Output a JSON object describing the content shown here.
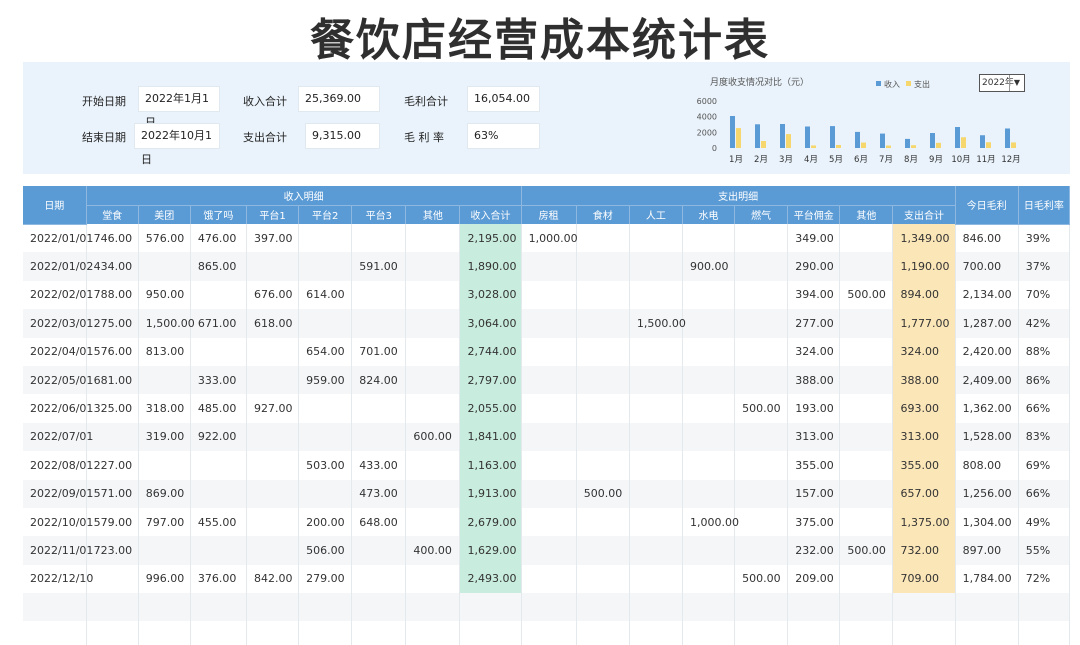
{
  "title": "餐饮店经营成本统计表",
  "summary": {
    "start_label": "开始日期",
    "start_value": "2022年1月1日",
    "end_label": "结束日期",
    "end_value": "2022年10月1日",
    "income_label": "收入合计",
    "income_value": "25,369.00",
    "expense_label": "支出合计",
    "expense_value": "9,315.00",
    "profit_label": "毛利合计",
    "profit_value": "16,054.00",
    "rate_label": "毛 利 率",
    "rate_value": "63%"
  },
  "year_select": "2022年",
  "chart_data": {
    "type": "bar",
    "title": "月度收支情况对比（元）",
    "categories": [
      "1月",
      "2月",
      "3月",
      "4月",
      "5月",
      "6月",
      "7月",
      "8月",
      "9月",
      "10月",
      "11月",
      "12月"
    ],
    "series": [
      {
        "name": "收入",
        "color": "#5b9bd5",
        "values": [
          4085,
          3028,
          3064,
          2744,
          2797,
          2055,
          1841,
          1163,
          1913,
          2679,
          1629,
          2493
        ]
      },
      {
        "name": "支出",
        "color": "#f5d76e",
        "values": [
          2539,
          894,
          1777,
          324,
          388,
          693,
          313,
          355,
          657,
          1375,
          732,
          709
        ]
      }
    ],
    "yticks": [
      "6000",
      "4000",
      "2000",
      "0"
    ],
    "ylim": [
      0,
      6000
    ],
    "legend": "top"
  },
  "table": {
    "date_header": "日期",
    "income_group": "收入明细",
    "expense_group": "支出明细",
    "today_profit_header": "今日毛利",
    "daily_rate_header": "日毛利率",
    "income_cols": [
      "堂食",
      "美团",
      "饿了吗",
      "平台1",
      "平台2",
      "平台3",
      "其他",
      "收入合计"
    ],
    "expense_cols": [
      "房租",
      "食材",
      "人工",
      "水电",
      "燃气",
      "平台佣金",
      "其他",
      "支出合计"
    ],
    "rows": [
      [
        "2022/01/01",
        "746.00",
        "576.00",
        "476.00",
        "397.00",
        "",
        "",
        "",
        "2,195.00",
        "1,000.00",
        "",
        "",
        "",
        "",
        "349.00",
        "",
        "1,349.00",
        "846.00",
        "39%"
      ],
      [
        "2022/01/02",
        "434.00",
        "",
        "865.00",
        "",
        "",
        "591.00",
        "",
        "1,890.00",
        "",
        "",
        "",
        "900.00",
        "",
        "290.00",
        "",
        "1,190.00",
        "700.00",
        "37%"
      ],
      [
        "2022/02/01",
        "788.00",
        "950.00",
        "",
        "676.00",
        "614.00",
        "",
        "",
        "3,028.00",
        "",
        "",
        "",
        "",
        "",
        "394.00",
        "500.00",
        "894.00",
        "2,134.00",
        "70%"
      ],
      [
        "2022/03/01",
        "275.00",
        "1,500.00",
        "671.00",
        "618.00",
        "",
        "",
        "",
        "3,064.00",
        "",
        "",
        "1,500.00",
        "",
        "",
        "277.00",
        "",
        "1,777.00",
        "1,287.00",
        "42%"
      ],
      [
        "2022/04/01",
        "576.00",
        "813.00",
        "",
        "",
        "654.00",
        "701.00",
        "",
        "2,744.00",
        "",
        "",
        "",
        "",
        "",
        "324.00",
        "",
        "324.00",
        "2,420.00",
        "88%"
      ],
      [
        "2022/05/01",
        "681.00",
        "",
        "333.00",
        "",
        "959.00",
        "824.00",
        "",
        "2,797.00",
        "",
        "",
        "",
        "",
        "",
        "388.00",
        "",
        "388.00",
        "2,409.00",
        "86%"
      ],
      [
        "2022/06/01",
        "325.00",
        "318.00",
        "485.00",
        "927.00",
        "",
        "",
        "",
        "2,055.00",
        "",
        "",
        "",
        "",
        "500.00",
        "193.00",
        "",
        "693.00",
        "1,362.00",
        "66%"
      ],
      [
        "2022/07/01",
        "",
        "319.00",
        "922.00",
        "",
        "",
        "",
        "600.00",
        "1,841.00",
        "",
        "",
        "",
        "",
        "",
        "313.00",
        "",
        "313.00",
        "1,528.00",
        "83%"
      ],
      [
        "2022/08/01",
        "227.00",
        "",
        "",
        "",
        "503.00",
        "433.00",
        "",
        "1,163.00",
        "",
        "",
        "",
        "",
        "",
        "355.00",
        "",
        "355.00",
        "808.00",
        "69%"
      ],
      [
        "2022/09/01",
        "571.00",
        "869.00",
        "",
        "",
        "",
        "473.00",
        "",
        "1,913.00",
        "",
        "500.00",
        "",
        "",
        "",
        "157.00",
        "",
        "657.00",
        "1,256.00",
        "66%"
      ],
      [
        "2022/10/01",
        "579.00",
        "797.00",
        "455.00",
        "",
        "200.00",
        "648.00",
        "",
        "2,679.00",
        "",
        "",
        "",
        "1,000.00",
        "",
        "375.00",
        "",
        "1,375.00",
        "1,304.00",
        "49%"
      ],
      [
        "2022/11/01",
        "723.00",
        "",
        "",
        "",
        "506.00",
        "",
        "400.00",
        "1,629.00",
        "",
        "",
        "",
        "",
        "",
        "232.00",
        "500.00",
        "732.00",
        "897.00",
        "55%"
      ],
      [
        "2022/12/10",
        "",
        "996.00",
        "376.00",
        "842.00",
        "279.00",
        "",
        "",
        "2,493.00",
        "",
        "",
        "",
        "",
        "500.00",
        "209.00",
        "",
        "709.00",
        "1,784.00",
        "72%"
      ]
    ]
  }
}
